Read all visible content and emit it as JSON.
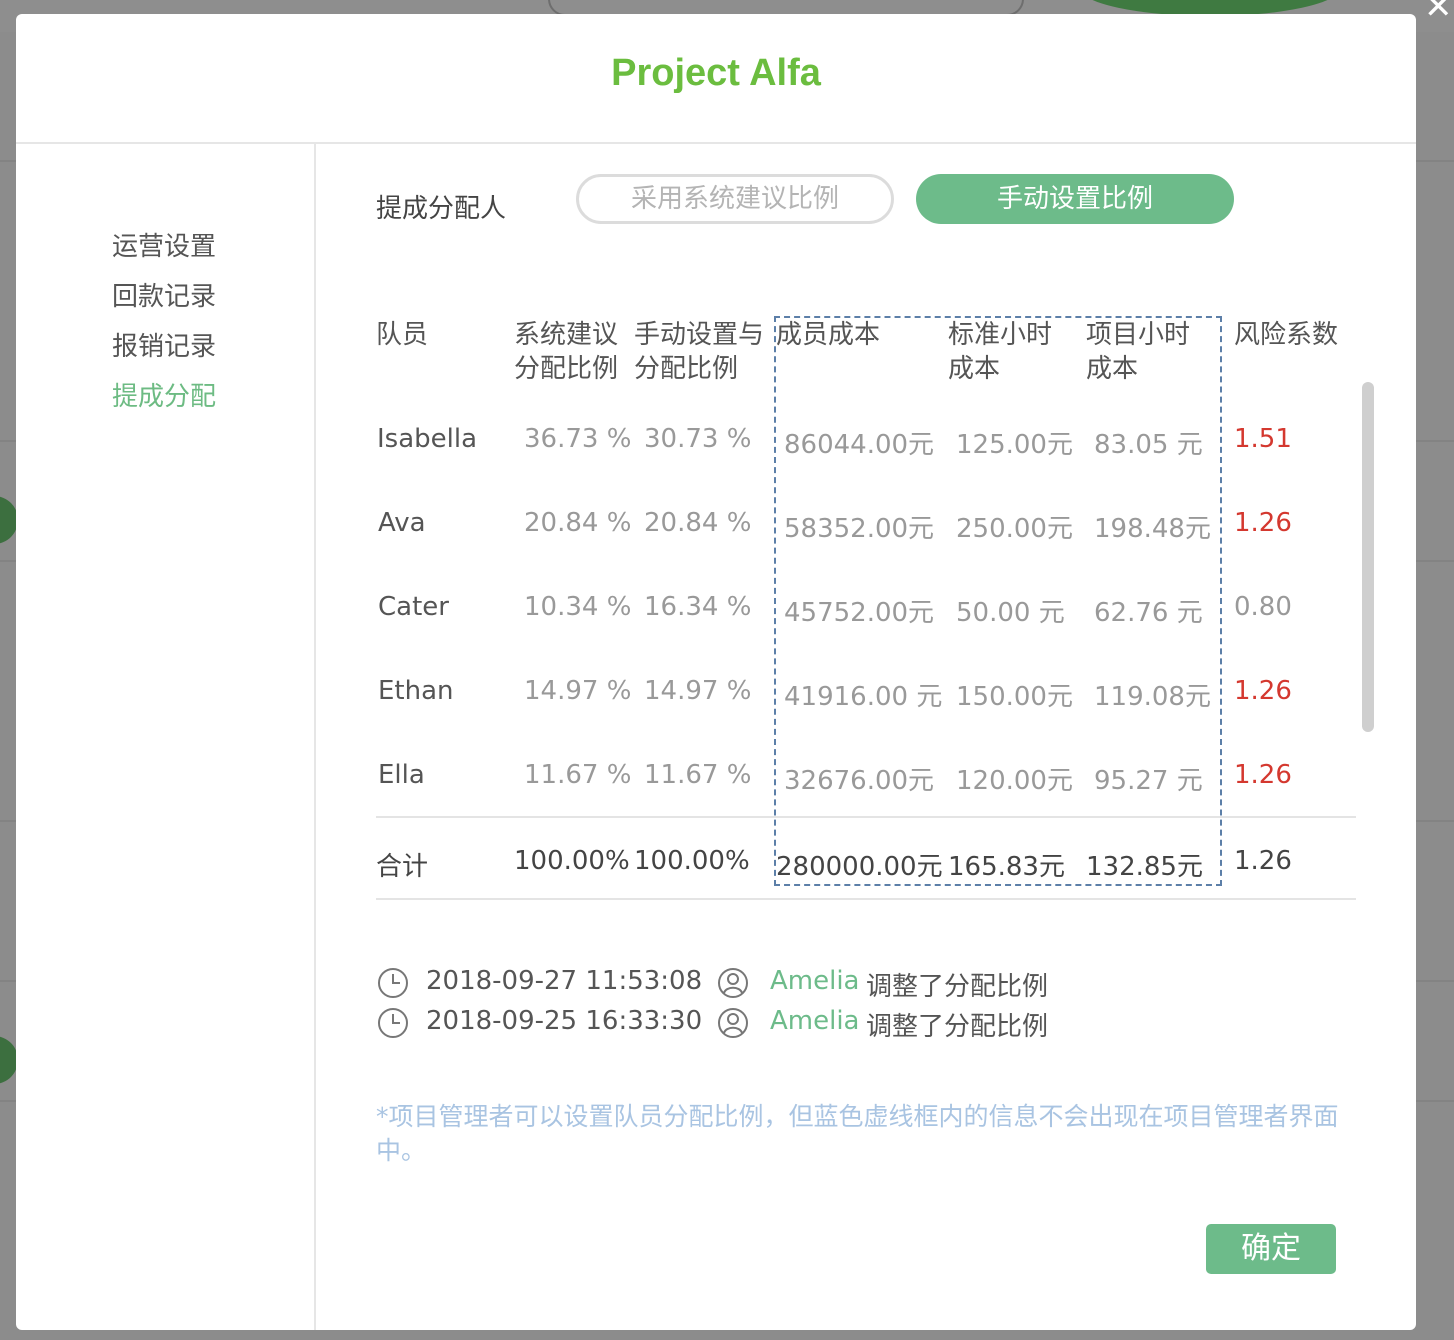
{
  "modal": {
    "title": "Project Alfa",
    "confirm_label": "确定"
  },
  "sidebar": {
    "items": [
      {
        "label": "运营设置",
        "active": false
      },
      {
        "label": "回款记录",
        "active": false
      },
      {
        "label": "报销记录",
        "active": false
      },
      {
        "label": "提成分配",
        "active": true
      }
    ]
  },
  "allocation": {
    "label": "提成分配人",
    "options": [
      "采用系统建议比例",
      "手动设置比例"
    ],
    "selected": "手动设置比例"
  },
  "table": {
    "headers": [
      [
        "队员"
      ],
      [
        "系统建议",
        "分配比例"
      ],
      [
        "手动设置与",
        "分配比例"
      ],
      [
        "成员成本"
      ],
      [
        "标准小时",
        "成本"
      ],
      [
        "项目小时",
        "成本"
      ],
      [
        "风险系数"
      ]
    ],
    "rows": [
      {
        "name": "Isabella",
        "system": "36.73 %",
        "manual": "30.73 %",
        "member_cost": "86044.00元",
        "std_hour_cost": "125.00元",
        "proj_hour_cost": "83.05 元",
        "risk": "1.51",
        "risk_high": true
      },
      {
        "name": "Ava",
        "system": "20.84 %",
        "manual": "20.84 %",
        "member_cost": "58352.00元",
        "std_hour_cost": "250.00元",
        "proj_hour_cost": "198.48元",
        "risk": "1.26",
        "risk_high": true
      },
      {
        "name": "Cater",
        "system": "10.34 %",
        "manual": "16.34 %",
        "member_cost": "45752.00元",
        "std_hour_cost": "50.00 元",
        "proj_hour_cost": "62.76 元",
        "risk": "0.80",
        "risk_high": false
      },
      {
        "name": "Ethan",
        "system": "14.97 %",
        "manual": "14.97 %",
        "member_cost": "41916.00 元",
        "std_hour_cost": "150.00元",
        "proj_hour_cost": "119.08元",
        "risk": "1.26",
        "risk_high": true
      },
      {
        "name": "Ella",
        "system": "11.67 %",
        "manual": "11.67 %",
        "member_cost": "32676.00元",
        "std_hour_cost": "120.00元",
        "proj_hour_cost": "95.27 元",
        "risk": "1.26",
        "risk_high": true
      }
    ],
    "total": {
      "label": "合计",
      "system": "100.00%",
      "manual": "100.00%",
      "member_cost": "280000.00元",
      "std_hour_cost": "165.83元",
      "proj_hour_cost": "132.85元",
      "risk": "1.26"
    }
  },
  "logs": [
    {
      "time": "2018-09-27 11:53:08",
      "user": "Amelia",
      "action": "调整了分配比例"
    },
    {
      "time": "2018-09-25 16:33:30",
      "user": "Amelia",
      "action": "调整了分配比例"
    }
  ],
  "note": "*项目管理者可以设置队员分配比例，但蓝色虚线框内的信息不会出现在项目管理者界面中。",
  "colors": {
    "accent": "#6dbb8a",
    "title": "#6bbd3f",
    "risk_high": "#d4382f",
    "note": "#a9c4e2",
    "dash_border": "#5c7fa8"
  }
}
